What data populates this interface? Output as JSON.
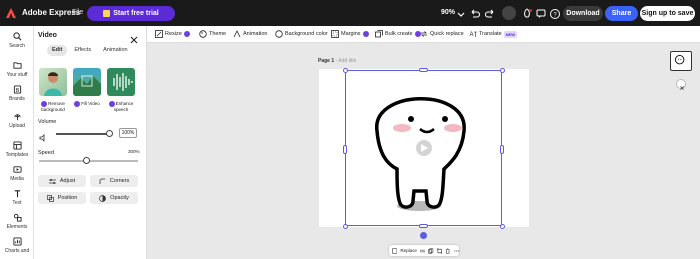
{
  "app": {
    "brand": "Adobe Express",
    "file_menu": "File"
  },
  "topbar": {
    "trial_label": "Start free trial",
    "zoom": "90%",
    "download_label": "Download",
    "share_label": "Share",
    "signup_label": "Sign up to save",
    "accent": "#5b2bd6",
    "share_color": "#3b63fb"
  },
  "nav": {
    "items": [
      {
        "label": "Search",
        "icon": "search-icon"
      },
      {
        "label": "Your stuff",
        "icon": "folder-icon"
      },
      {
        "label": "Brands",
        "icon": "brand-icon"
      },
      {
        "label": "Upload",
        "icon": "upload-icon"
      },
      {
        "label": "Templates",
        "icon": "templates-icon"
      },
      {
        "label": "Media",
        "icon": "media-icon"
      },
      {
        "label": "Text",
        "icon": "text-icon"
      },
      {
        "label": "Elements",
        "icon": "elements-icon"
      },
      {
        "label": "Charts and",
        "icon": "charts-icon"
      }
    ]
  },
  "panel": {
    "title": "Video",
    "tabs": [
      "Edit",
      "Effects",
      "Animation"
    ],
    "active_tab": "Edit",
    "quick": [
      {
        "label": "Remove background"
      },
      {
        "label": "Fill Video"
      },
      {
        "label": "Enhance speech"
      }
    ],
    "volume_label": "Volume",
    "volume_value": "100%",
    "speed_label": "Speed",
    "speed_max": "300%",
    "buttons": {
      "adjust": "Adjust",
      "corners": "Corners",
      "position": "Position",
      "opacity": "Opacity"
    }
  },
  "context_toolbar": {
    "resize": "Resize",
    "theme": "Theme",
    "animation": "Animation",
    "background": "Background color",
    "margins": "Margins",
    "bulk": "Bulk create",
    "quick_replace": "Quick replace",
    "translate": "Translate",
    "new_badge": "NEW"
  },
  "canvas": {
    "page_label": "Page 1",
    "page_sep": " - ",
    "add_title": "Add title",
    "float_replace": "Replace",
    "selection_color": "#5c5ce0"
  }
}
